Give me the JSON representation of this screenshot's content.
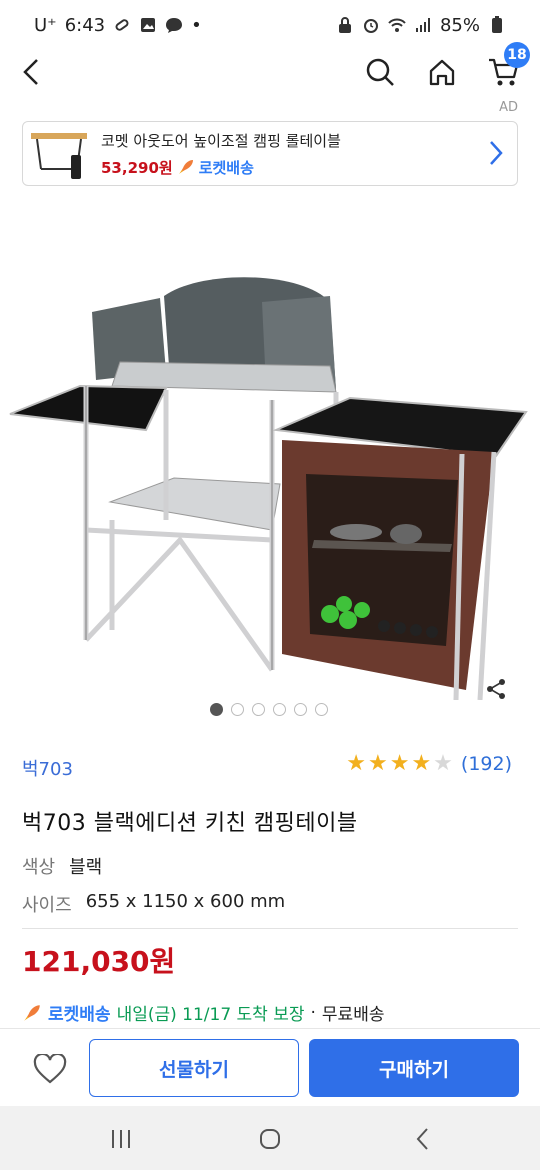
{
  "status_bar": {
    "carrier": "U⁺",
    "time": "6:43",
    "battery": "85%"
  },
  "header": {
    "back_icon": "chevron-left-icon",
    "search_icon": "search-icon",
    "home_icon": "home-icon",
    "cart_icon": "cart-icon",
    "cart_count": "18"
  },
  "ad": {
    "label": "AD",
    "title": "코멧 아웃도어 높이조절 캠핑 롤테이블",
    "price": "53,290원",
    "rocket_label": "로켓배송"
  },
  "gallery": {
    "dots": 6,
    "active_index": 0
  },
  "product": {
    "brand": "벅703",
    "rating_stars": 4,
    "rating_max": 5,
    "review_count": "(192)",
    "title": "벅703 블랙에디션 키친 캠핑테이블",
    "color_label": "색상",
    "color_value": "블랙",
    "size_label": "사이즈",
    "size_value": "655 x 1150 x 600 mm",
    "price": "121,030원"
  },
  "delivery": {
    "rocket_label": "로켓배송",
    "date_text": "내일(금) 11/17 도착 보장",
    "separator": "·",
    "free_text": "무료배송"
  },
  "bottom_bar": {
    "wish_icon": "heart-icon",
    "gift_label": "선물하기",
    "buy_label": "구매하기"
  },
  "colors": {
    "accent": "#2f6fe8",
    "price": "#c7111c",
    "delivery_date": "#0a9b54",
    "star": "#f2b01e"
  }
}
